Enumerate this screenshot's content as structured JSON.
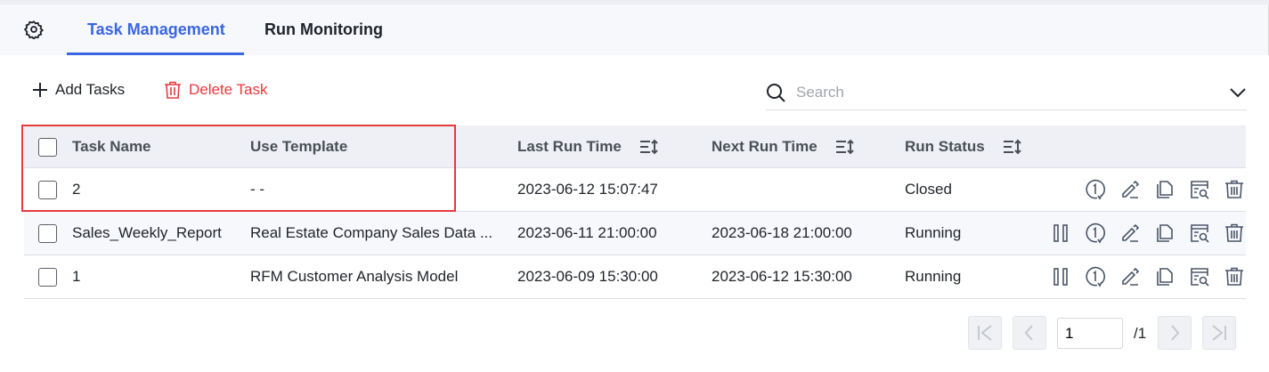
{
  "tabs": [
    {
      "label": "Task Management",
      "active": true
    },
    {
      "label": "Run Monitoring",
      "active": false
    }
  ],
  "toolbar": {
    "add_label": "Add Tasks",
    "delete_label": "Delete Task"
  },
  "search": {
    "placeholder": "Search",
    "value": ""
  },
  "table": {
    "headers": {
      "task_name": "Task Name",
      "use_template": "Use Template",
      "last_run": "Last Run Time",
      "next_run": "Next Run Time",
      "run_status": "Run Status"
    },
    "rows": [
      {
        "task_name": "2",
        "use_template": "- -",
        "last_run": "2023-06-12 15:07:47",
        "next_run": "",
        "run_status": "Closed"
      },
      {
        "task_name": "Sales_Weekly_Report",
        "use_template": "Real Estate Company Sales Data ...",
        "last_run": "2023-06-11 21:00:00",
        "next_run": "2023-06-18 21:00:00",
        "run_status": "Running"
      },
      {
        "task_name": "1",
        "use_template": "RFM Customer Analysis Model",
        "last_run": "2023-06-09 15:30:00",
        "next_run": "2023-06-12 15:30:00",
        "run_status": "Running"
      }
    ]
  },
  "pagination": {
    "current": "1",
    "total": "/1"
  },
  "colors": {
    "accent": "#3a66e0",
    "danger": "#e8393d"
  }
}
